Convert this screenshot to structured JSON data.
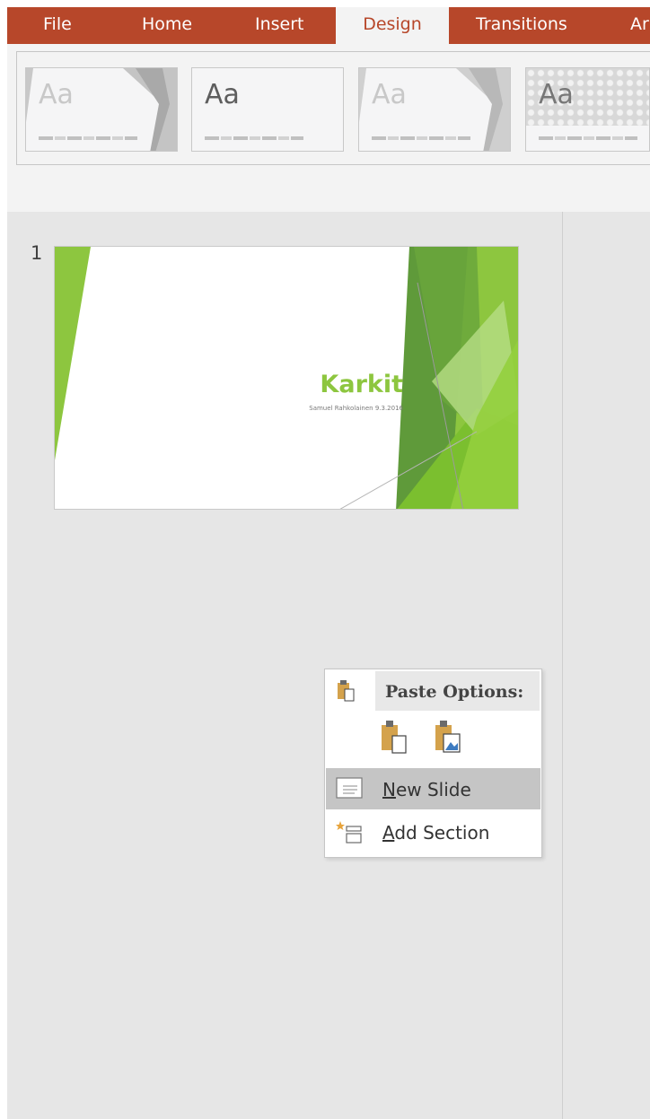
{
  "ribbon_tabs": {
    "file": "File",
    "home": "Home",
    "insert": "Insert",
    "design": "Design",
    "transitions": "Transitions",
    "animations_partial": "Ar"
  },
  "themes": [
    {
      "label": "Aa",
      "style": "facet-gray"
    },
    {
      "label": "Aa",
      "style": "office-plain"
    },
    {
      "label": "Aa",
      "style": "facet-light"
    },
    {
      "label": "Aa",
      "style": "pattern"
    }
  ],
  "slides": {
    "number": "1",
    "title": "Karkit",
    "subtitle": "Samuel Rahkolainen 9.3.2016",
    "accent_color": "#8dc63f"
  },
  "context_menu": {
    "paste_options_label": "Paste Options:",
    "new_slide": {
      "mnemonic": "N",
      "rest": "ew Slide"
    },
    "add_section": {
      "mnemonic": "A",
      "rest": "dd Section"
    }
  },
  "colors": {
    "tab_bar": "#b7472a",
    "ribbon": "#f3f3f3",
    "panel": "#e6e6e6"
  }
}
